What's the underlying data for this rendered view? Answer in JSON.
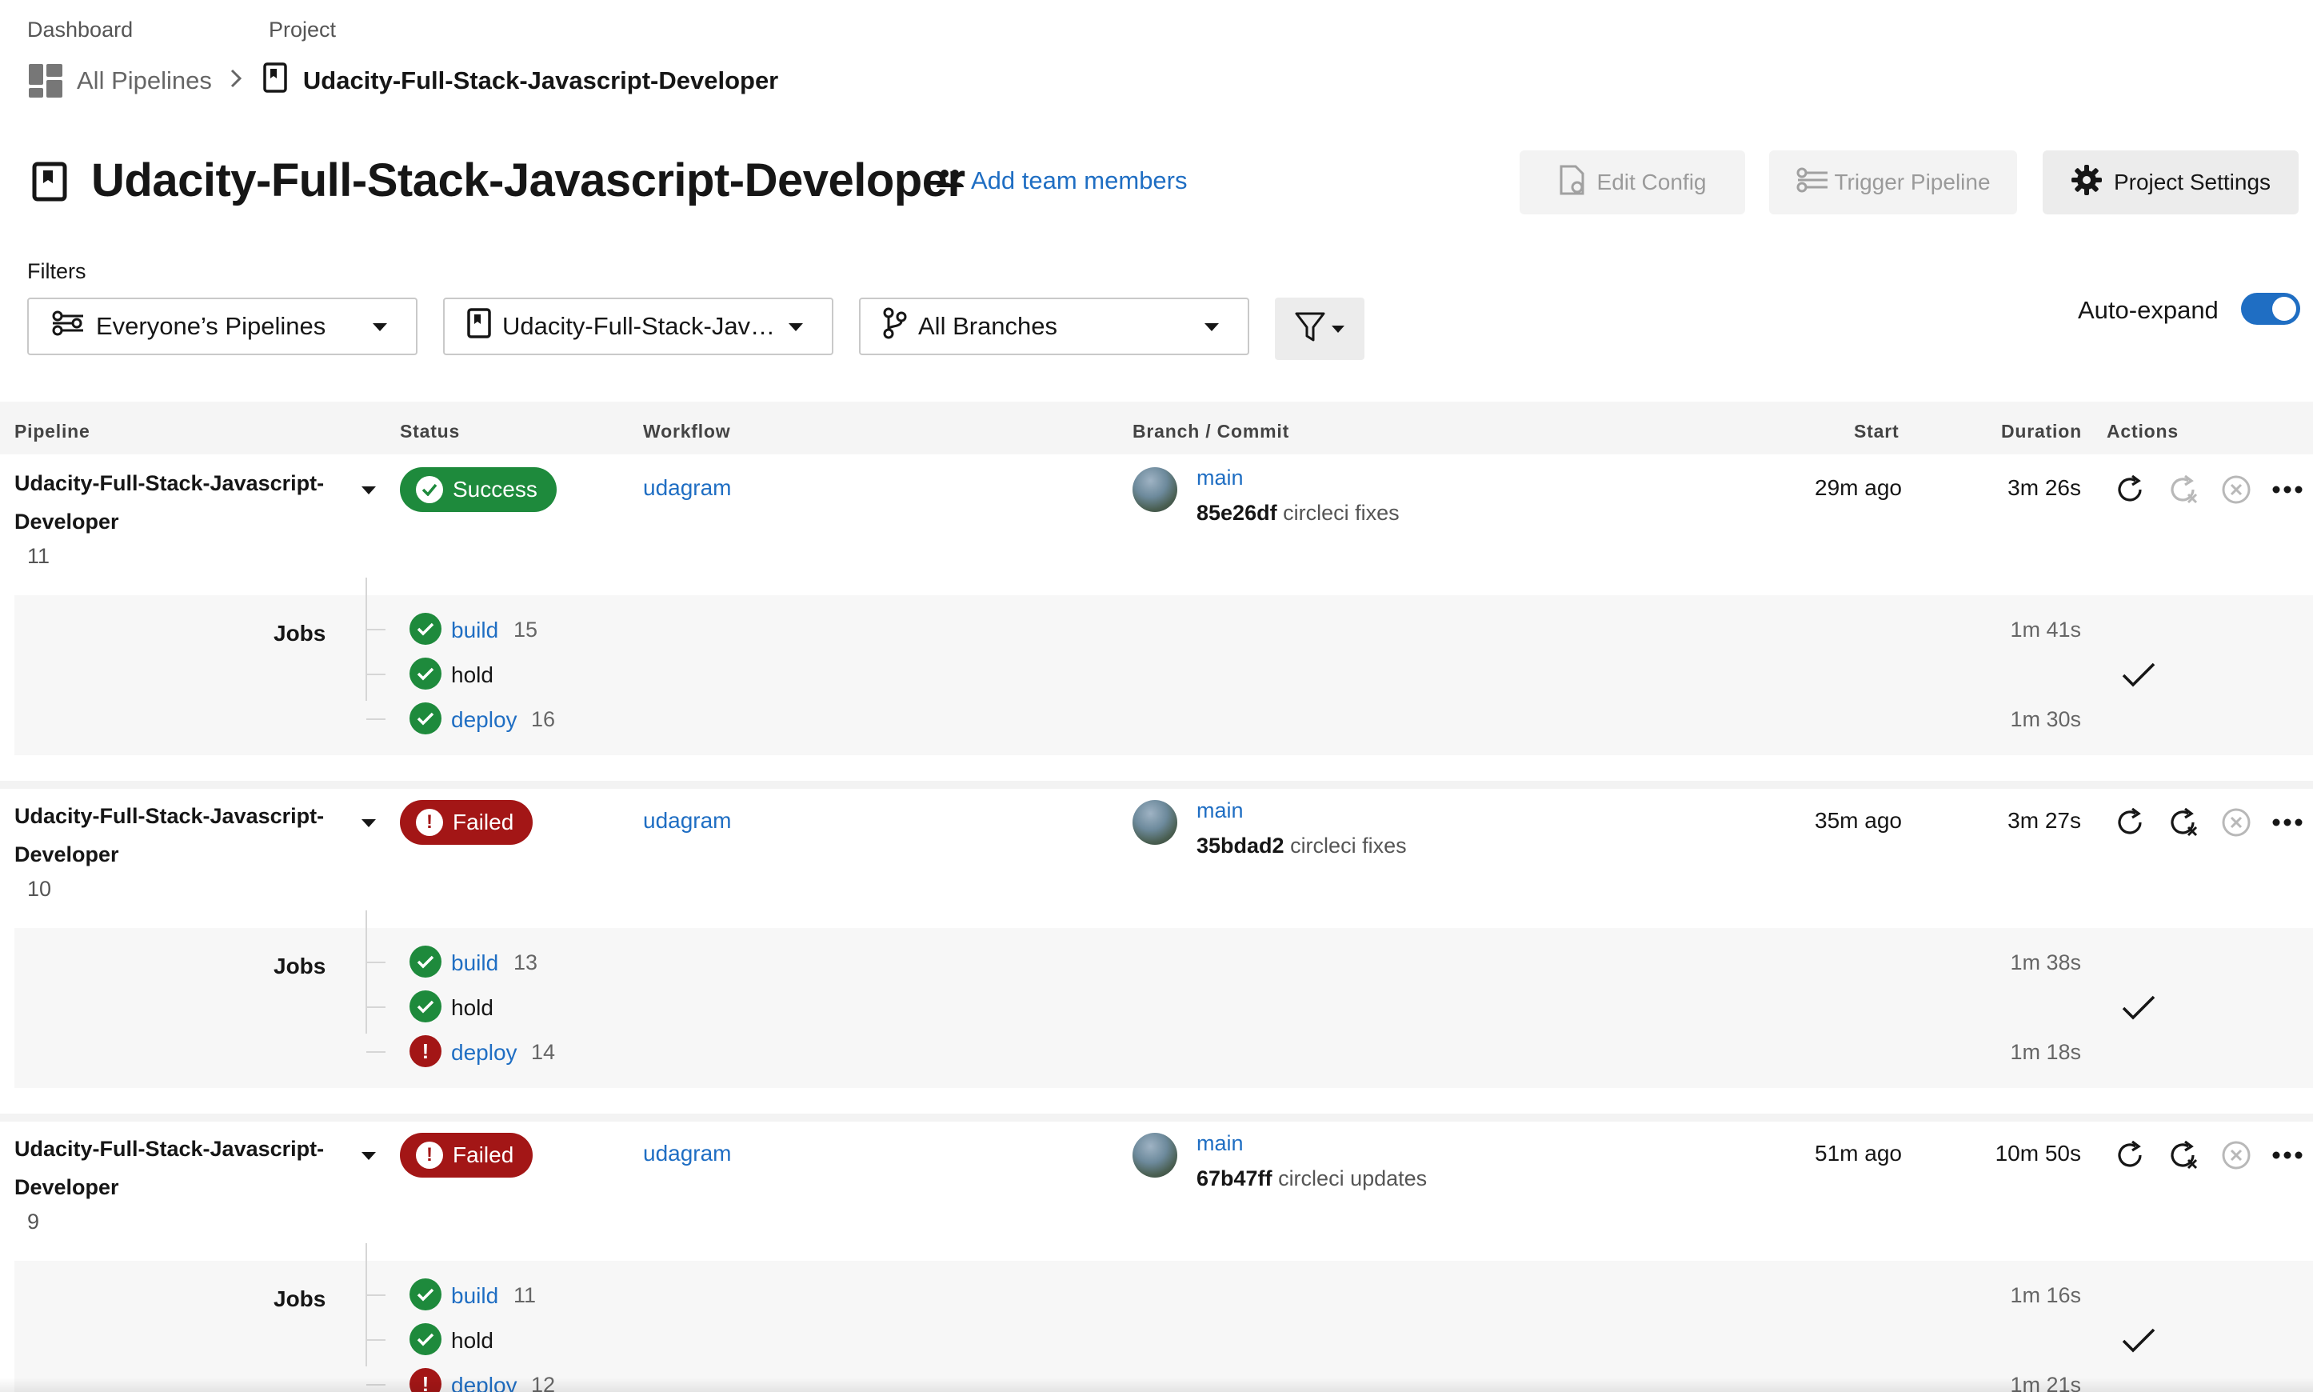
{
  "breadcrumb": {
    "dashboard_label": "Dashboard",
    "project_label": "Project",
    "all_pipelines": "All Pipelines",
    "project_name": "Udacity-Full-Stack-Javascript-Developer"
  },
  "header": {
    "title": "Udacity-Full-Stack-Javascript-Developer",
    "add_team_members": "Add team members",
    "edit_config": "Edit Config",
    "trigger_pipeline": "Trigger Pipeline",
    "project_settings": "Project Settings"
  },
  "filters": {
    "label": "Filters",
    "pipelines": "Everyone’s Pipelines",
    "project": "Udacity-Full-Stack-Jav…",
    "branches": "All Branches",
    "auto_expand_label": "Auto-expand",
    "auto_expand_on": true
  },
  "table": {
    "columns": [
      "Pipeline",
      "Status",
      "Workflow",
      "Branch / Commit",
      "Start",
      "Duration",
      "Actions"
    ],
    "jobs_label": "Jobs",
    "rows": [
      {
        "name_line1": "Udacity-Full-Stack-Javascript-",
        "name_line2": "Developer",
        "number": "11",
        "status": "Success",
        "workflow": "udagram",
        "branch": "main",
        "commit_hash": "85e26df",
        "commit_msg": "circleci fixes",
        "start": "29m ago",
        "duration": "3m 26s",
        "jobs": [
          {
            "name": "build",
            "number": "15",
            "state": "success",
            "duration": "1m 41s"
          },
          {
            "name": "hold",
            "number": "",
            "state": "success",
            "duration": ""
          },
          {
            "name": "deploy",
            "number": "16",
            "state": "success",
            "duration": "1m 30s"
          }
        ]
      },
      {
        "name_line1": "Udacity-Full-Stack-Javascript-",
        "name_line2": "Developer",
        "number": "10",
        "status": "Failed",
        "workflow": "udagram",
        "branch": "main",
        "commit_hash": "35bdad2",
        "commit_msg": "circleci fixes",
        "start": "35m ago",
        "duration": "3m 27s",
        "jobs": [
          {
            "name": "build",
            "number": "13",
            "state": "success",
            "duration": "1m 38s"
          },
          {
            "name": "hold",
            "number": "",
            "state": "success",
            "duration": ""
          },
          {
            "name": "deploy",
            "number": "14",
            "state": "failed",
            "duration": "1m 18s"
          }
        ]
      },
      {
        "name_line1": "Udacity-Full-Stack-Javascript-",
        "name_line2": "Developer",
        "number": "9",
        "status": "Failed",
        "workflow": "udagram",
        "branch": "main",
        "commit_hash": "67b47ff",
        "commit_msg": "circleci updates",
        "start": "51m ago",
        "duration": "10m 50s",
        "jobs": [
          {
            "name": "build",
            "number": "11",
            "state": "success",
            "duration": "1m 16s"
          },
          {
            "name": "hold",
            "number": "",
            "state": "success",
            "duration": ""
          },
          {
            "name": "deploy",
            "number": "12",
            "state": "failed",
            "duration": "1m 21s"
          }
        ]
      }
    ]
  },
  "colors": {
    "accent": "#1f6ec3",
    "success": "#1e8a3c",
    "failed": "#a31616"
  }
}
